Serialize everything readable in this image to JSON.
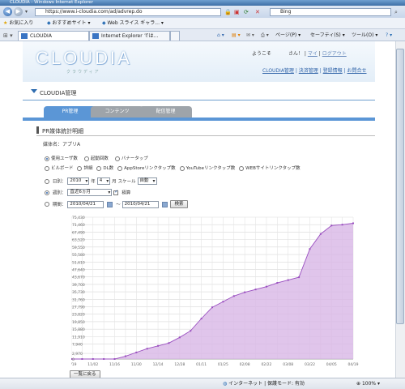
{
  "window": {
    "title": "CLOUDIA - Windows Internet Explorer"
  },
  "address": {
    "url": "https://www.i-cloudia.com/ad/advrep.do",
    "search_placeholder": "Bing"
  },
  "favorites_bar": {
    "favorites": "お気に入り",
    "suggested": "おすすめサイト",
    "webslice": "Web スライス ギャラ..."
  },
  "tabs": [
    {
      "label": "CLOUDIA"
    },
    {
      "label": "Internet Explorer では..."
    }
  ],
  "commands": {
    "page": "ページ(P)",
    "safety": "セーフティ(S)",
    "tools": "ツール(O)",
    "help": "?"
  },
  "site": {
    "logo": "CLOUDIA",
    "logo_sub": "クラウディア",
    "welcome_prefix": "ようこそ",
    "welcome_suffix": "さん！",
    "mypage": "マイ",
    "logout": "ログアウト",
    "links": [
      "CLOUDIA管理",
      "決済管理",
      "登録情報",
      "お問合せ"
    ]
  },
  "section_title": "CLOUDIA管理",
  "page_tabs": [
    {
      "label": "PR管理"
    },
    {
      "label": "コンテンツ"
    },
    {
      "label": "配信管理"
    }
  ],
  "report": {
    "title": "PR媒体統計明細",
    "media_label": "媒体名：アプリA",
    "metrics_row1": [
      "使用ユーザ数",
      "起動回数",
      "バナータップ"
    ],
    "metrics_row2": [
      "ビルボード",
      "詳細",
      "DL数",
      "AppStoreリンクタップ数",
      "YouTubeリンクタップ数",
      "WEBサイトリンクタップ数"
    ],
    "daily": {
      "label": "日別：",
      "year": "2010",
      "year_unit": "年",
      "month": "4",
      "month_unit": "月",
      "scale_label": "スケール",
      "scale": "自動"
    },
    "weekly": {
      "label": "週別：",
      "period": "直近6ヵ月",
      "cumulative": "積算"
    },
    "period": {
      "label": "期間：",
      "from": "2010/04/21",
      "tilde": "〜",
      "to": "2010/04/21",
      "search": "検索"
    },
    "back": "一覧に戻る"
  },
  "chart_data": {
    "type": "area",
    "x": [
      "10/19",
      "10/26",
      "11/02",
      "11/09",
      "11/16",
      "11/23",
      "11/30",
      "12/07",
      "12/14",
      "12/21",
      "12/28",
      "01/04",
      "01/11",
      "01/18",
      "01/25",
      "02/01",
      "02/08",
      "02/15",
      "02/22",
      "03/01",
      "03/08",
      "03/15",
      "03/22",
      "03/29",
      "04/05",
      "04/12",
      "04/19"
    ],
    "x_ticks": [
      "10/19",
      "11/02",
      "11/16",
      "11/30",
      "12/14",
      "12/28",
      "01/11",
      "01/25",
      "02/08",
      "02/22",
      "03/08",
      "03/22",
      "04/05",
      "04/19"
    ],
    "values": [
      0,
      0,
      0,
      0,
      0,
      1500,
      3500,
      5500,
      7000,
      8500,
      11500,
      15000,
      21500,
      27500,
      30500,
      33500,
      35500,
      37000,
      38500,
      40500,
      42000,
      43500,
      58500,
      66500,
      71000,
      71460,
      72200
    ],
    "y_ticks": [
      0,
      2970,
      7940,
      11910,
      15880,
      19850,
      23820,
      27790,
      31760,
      35730,
      39700,
      43670,
      47640,
      51610,
      55580,
      59550,
      63520,
      67490,
      71460,
      75430
    ],
    "ylim": [
      0,
      75430
    ],
    "colors": {
      "fill": "#d8b6e6",
      "line": "#9a4fc0"
    },
    "grid": true
  },
  "status": {
    "zone": "インターネット | 保護モード: 有効",
    "zoom": "100%"
  }
}
